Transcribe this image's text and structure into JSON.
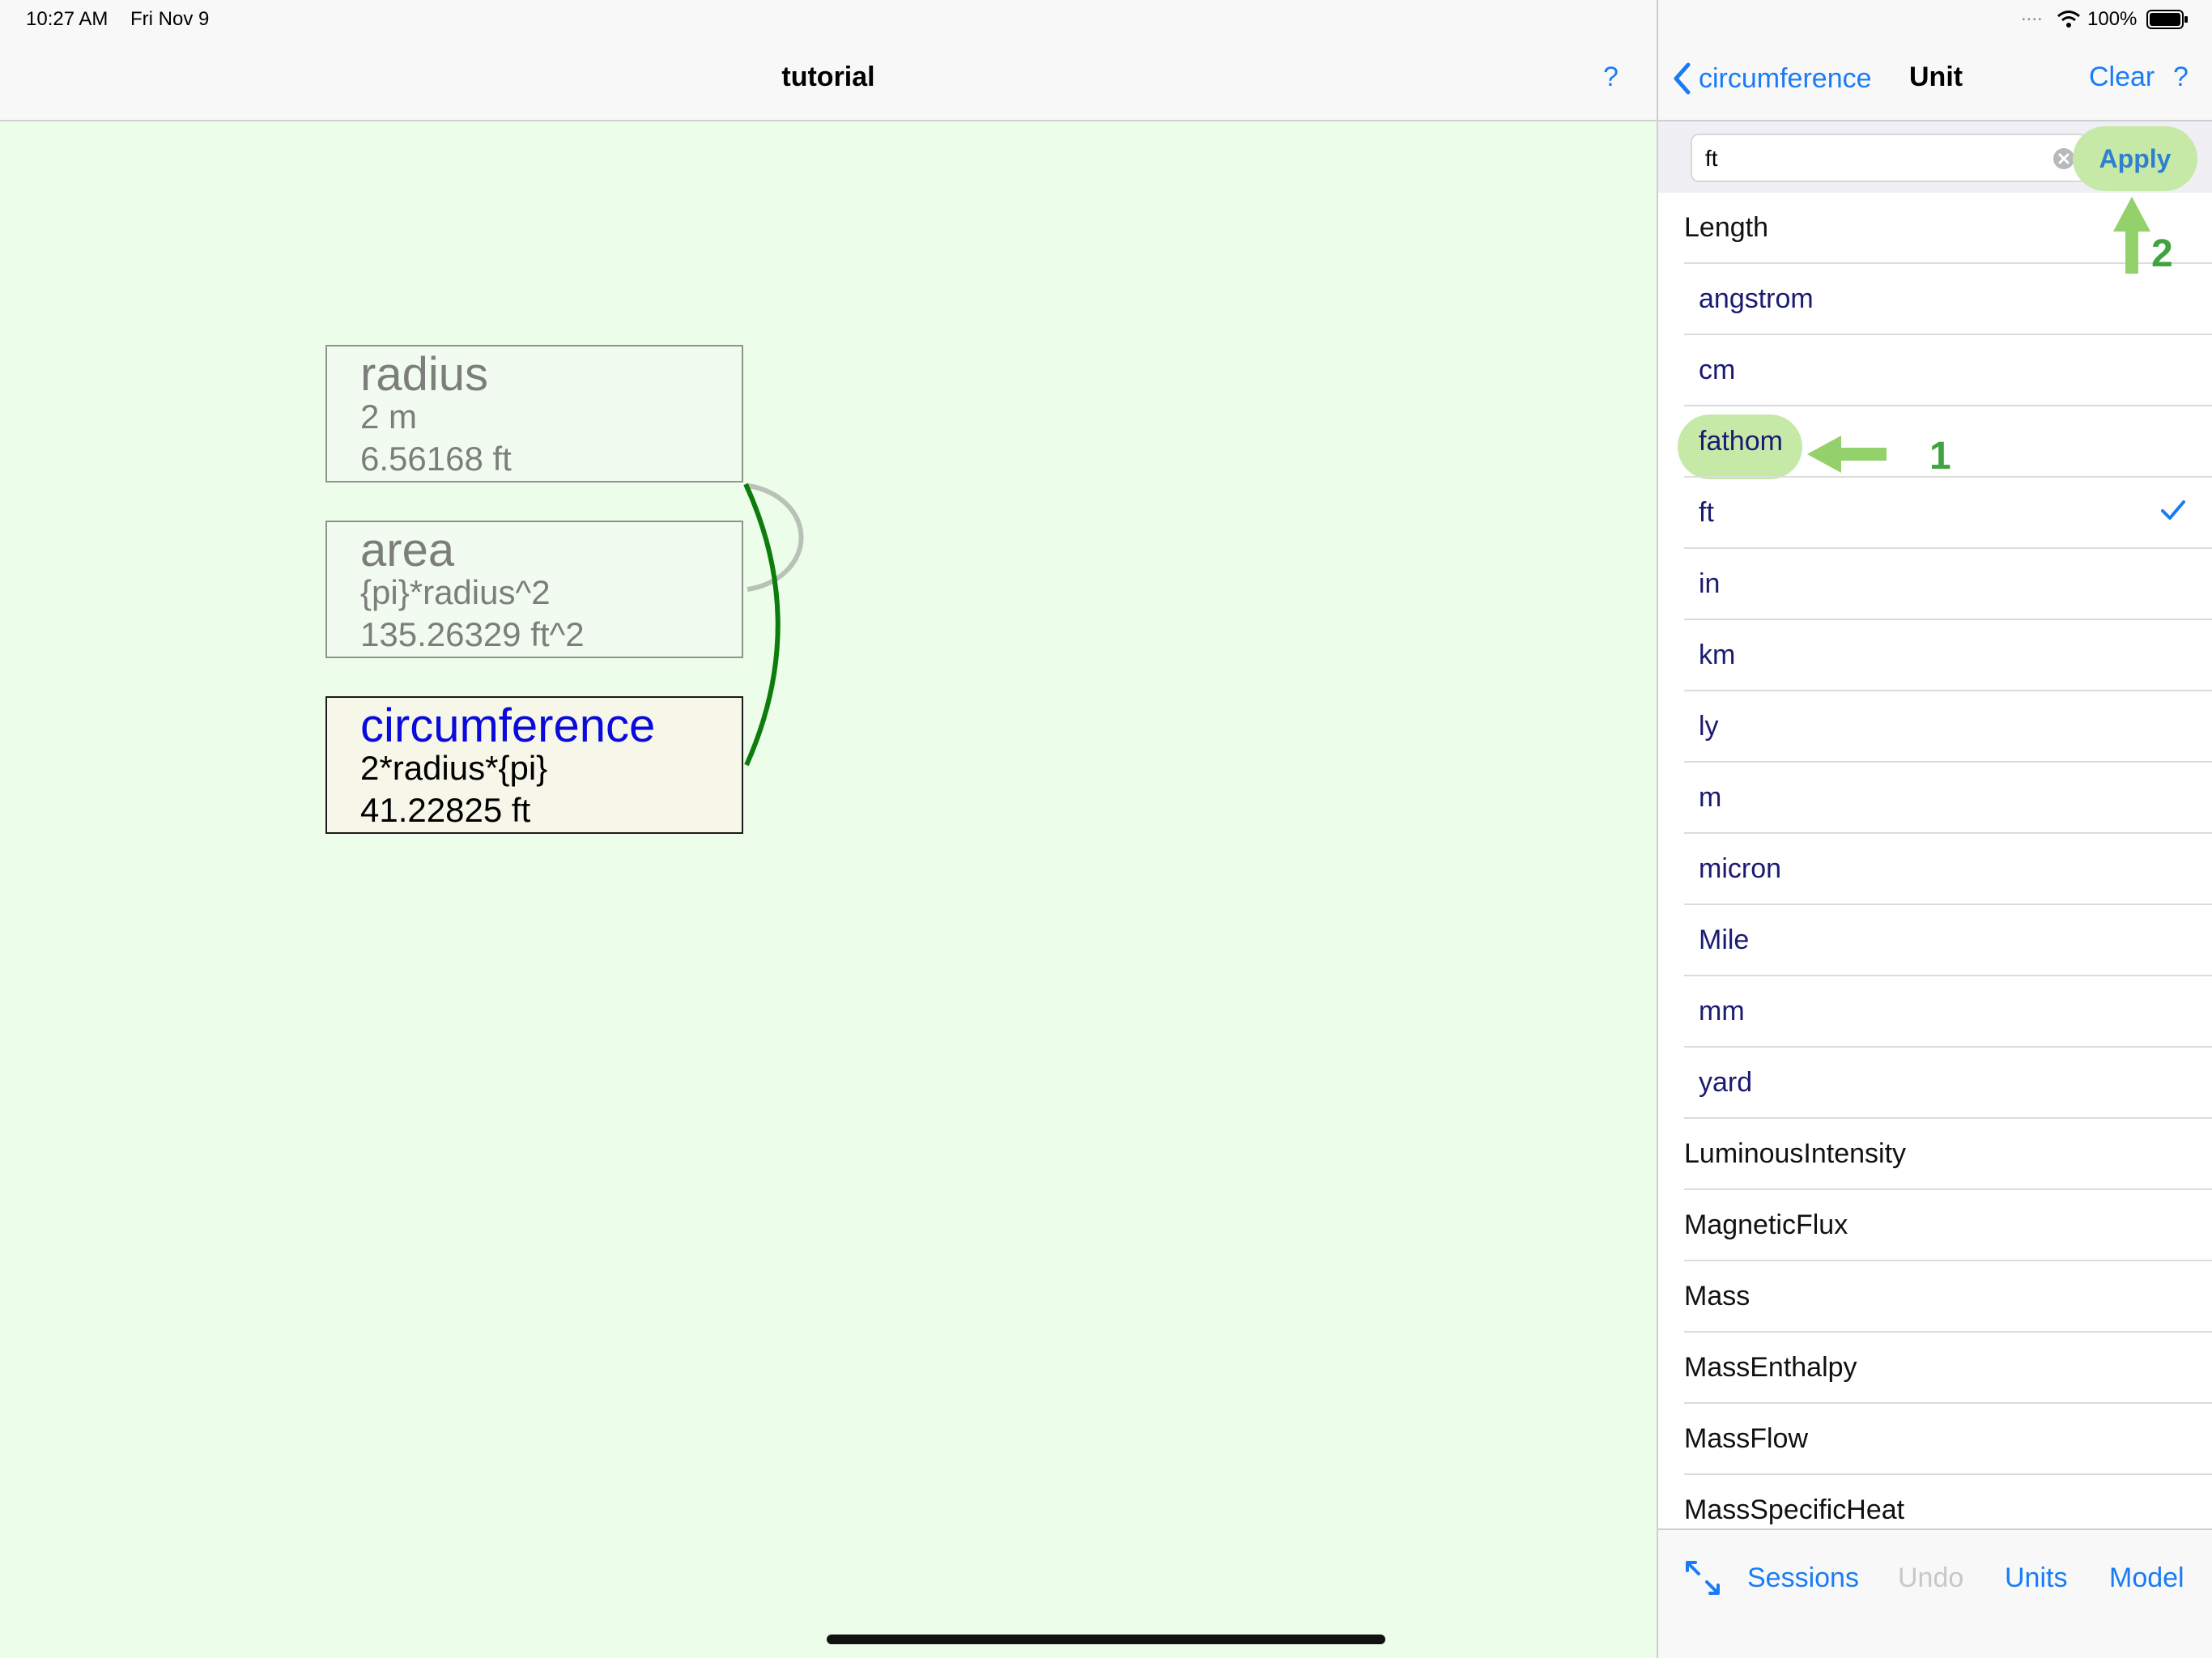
{
  "status_bar": {
    "time": "10:27 AM",
    "date": "Fri Nov 9",
    "battery": "100%",
    "signal_dots": "....",
    "wifi_icon": "wifi-icon",
    "battery_icon": "battery-icon"
  },
  "left_pane": {
    "title": "tutorial",
    "help_label": "?",
    "nodes": [
      {
        "name": "radius",
        "line1": "2 m",
        "line2": "6.56168 ft",
        "state": "dim"
      },
      {
        "name": "area",
        "line1": "{pi}*radius^2",
        "line2": "135.26329 ft^2",
        "state": "dim"
      },
      {
        "name": "circumference",
        "line1": "2*radius*{pi}",
        "line2": "41.22825 ft",
        "state": "selected"
      }
    ],
    "colors": {
      "background": "#ecfeea",
      "selected_name": "#0a0adc",
      "link_active": "#0c7d0c",
      "link_dim": "#b9c2b7"
    }
  },
  "right_pane": {
    "back_label": "circumference",
    "title": "Unit",
    "clear_label": "Clear",
    "help_label": "?",
    "search": {
      "value": "ft",
      "placeholder": ""
    },
    "apply_label": "Apply",
    "list": [
      {
        "type": "category",
        "label": "Length"
      },
      {
        "type": "unit",
        "label": "angstrom"
      },
      {
        "type": "unit",
        "label": "cm"
      },
      {
        "type": "unit",
        "label": "fathom",
        "highlighted": true
      },
      {
        "type": "unit",
        "label": "ft",
        "checked": true
      },
      {
        "type": "unit",
        "label": "in"
      },
      {
        "type": "unit",
        "label": "km"
      },
      {
        "type": "unit",
        "label": "ly"
      },
      {
        "type": "unit",
        "label": "m"
      },
      {
        "type": "unit",
        "label": "micron"
      },
      {
        "type": "unit",
        "label": "Mile"
      },
      {
        "type": "unit",
        "label": "mm"
      },
      {
        "type": "unit",
        "label": "yard"
      },
      {
        "type": "category",
        "label": "LuminousIntensity"
      },
      {
        "type": "category",
        "label": "MagneticFlux"
      },
      {
        "type": "category",
        "label": "Mass"
      },
      {
        "type": "category",
        "label": "MassEnthalpy"
      },
      {
        "type": "category",
        "label": "MassFlow"
      },
      {
        "type": "category",
        "label": "MassSpecificHeat"
      }
    ],
    "annotations": {
      "step1": "1",
      "step2": "2"
    },
    "toolbar": {
      "expand_icon": "expand-arrows-icon",
      "sessions": "Sessions",
      "undo": "Undo",
      "units": "Units",
      "model": "Model"
    },
    "colors": {
      "accent": "#1a7cf5",
      "highlight": "#c6e9a8",
      "annotation": "#3fa33f"
    }
  }
}
